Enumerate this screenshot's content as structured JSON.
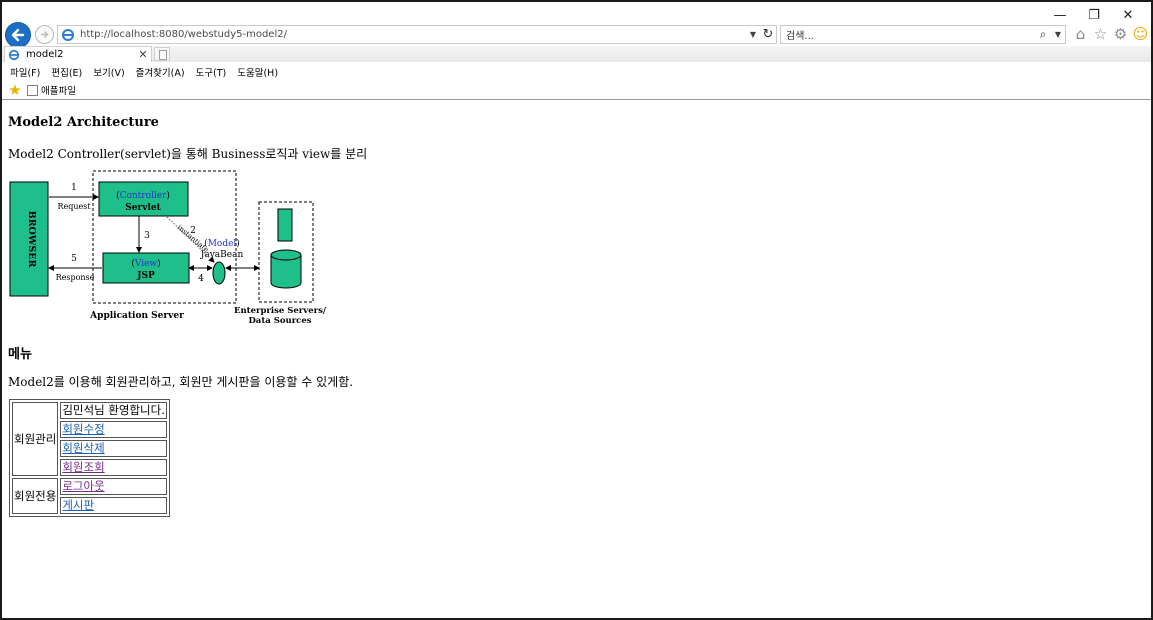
{
  "browser": {
    "address_url": "http://localhost:8080/webstudy5-model2/",
    "search_placeholder": "검색...",
    "tab_title": "model2",
    "menu": [
      "파일(F)",
      "편집(E)",
      "보기(V)",
      "즐겨찾기(A)",
      "도구(T)",
      "도움말(H)"
    ],
    "favorites": [
      {
        "label": "애플파일"
      }
    ]
  },
  "page": {
    "heading_arch": "Model2 Architecture",
    "description": "Model2 Controller(servlet)을 통해 Business로직과 view를 분리",
    "diagram": {
      "browser_label": "BROWSER",
      "controller_label": "Controller",
      "servlet_label": "Servlet",
      "view_label": "View",
      "jsp_label": "JSP",
      "model_label": "Model",
      "javabean_label": "JavaBean",
      "instantiate_label": "instantiate",
      "request_label": "Request",
      "response_label": "Response",
      "step1": "1",
      "step2": "2",
      "step3": "3",
      "step4": "4",
      "step5": "5",
      "app_server_label": "Application Server",
      "enterprise_label_1": "Enterprise Servers/",
      "enterprise_label_2": "Data Sources"
    },
    "heading_menu": "메뉴",
    "menu_desc": "Model2를 이용해 회원관리하고, 회원만 게시판을 이용할 수 있게함.",
    "table": {
      "group1": "회원관리",
      "welcome": "김민석님 환영합니다.",
      "link_edit": "회원수정",
      "link_delete": "회원삭제",
      "link_search": "회원조회",
      "group2": "회원전용",
      "link_logout": "로그아웃",
      "link_board": "게시판"
    }
  },
  "colors": {
    "box_fill": "#1fbf8c",
    "accent_blue": "#2233cc",
    "link": "#1a5fb4",
    "visited_link": "#7a2a8c"
  }
}
